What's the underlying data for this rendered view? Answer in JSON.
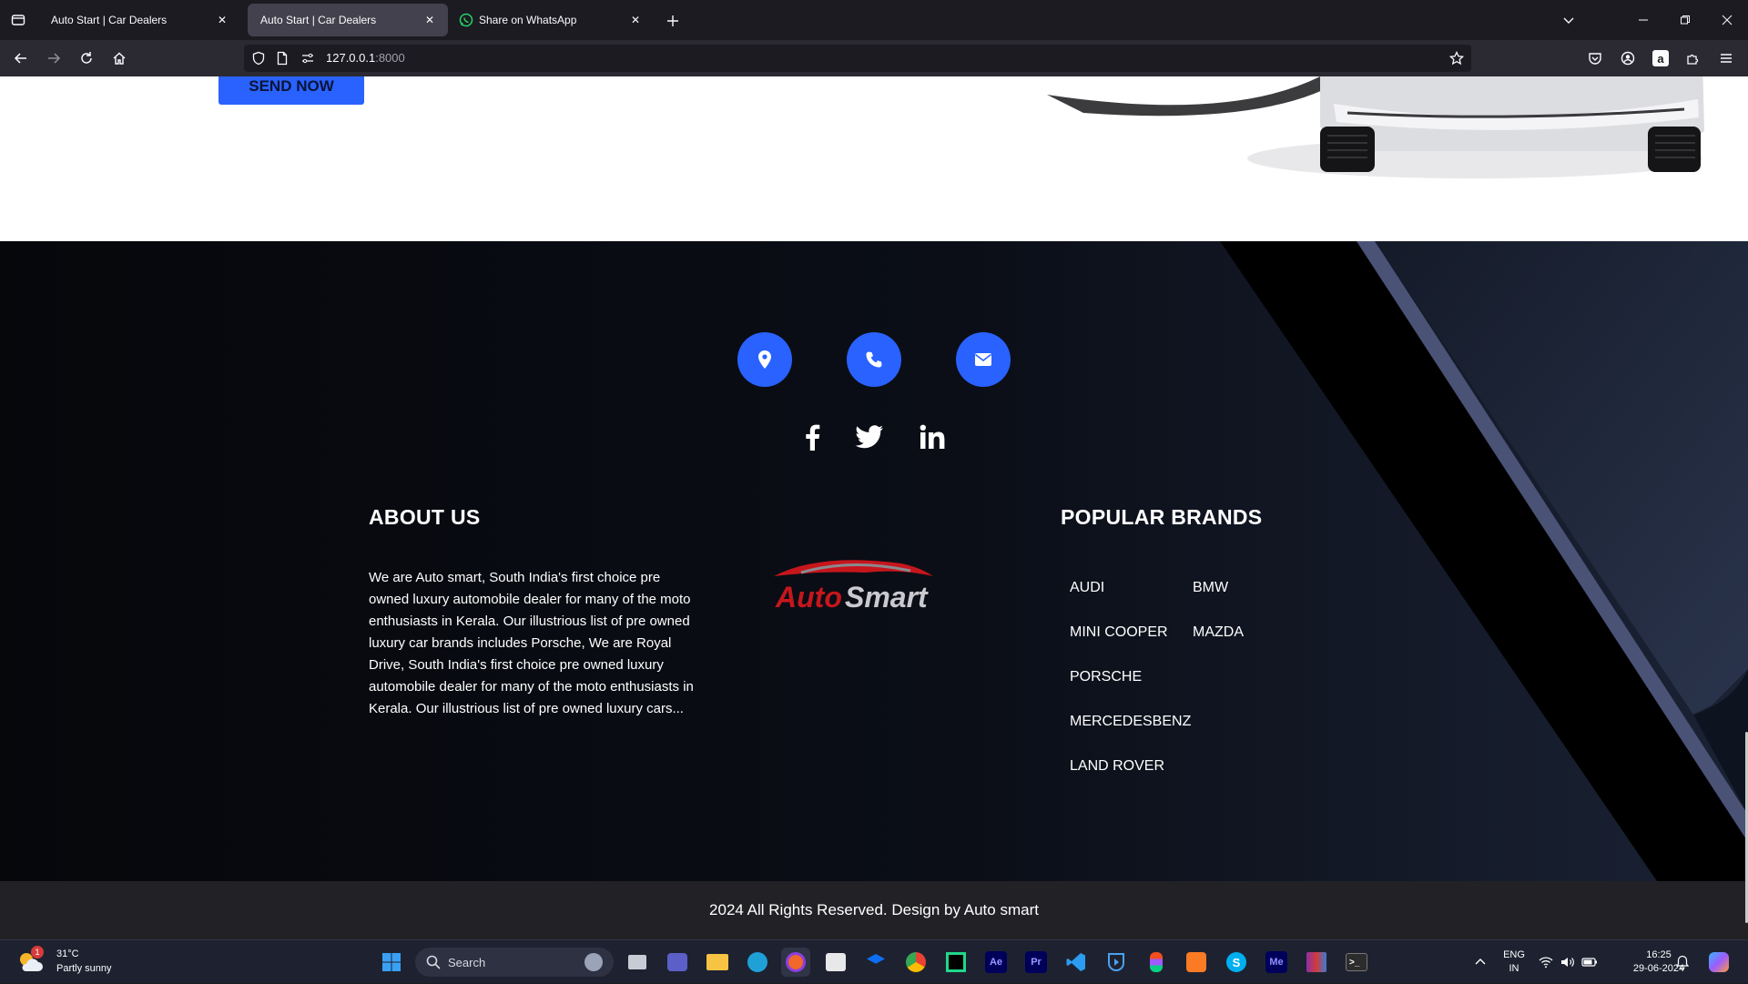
{
  "browser": {
    "tabs": [
      {
        "title": "Auto Start | Car Dealers",
        "active": false
      },
      {
        "title": "Auto Start | Car Dealers",
        "active": true
      },
      {
        "title": "Share on WhatsApp",
        "active": false
      }
    ],
    "url_host": "127.0.0.1",
    "url_port": ":8000"
  },
  "page": {
    "send_button": "SEND NOW",
    "contact_icons": [
      "location-pin-icon",
      "phone-icon",
      "envelope-icon"
    ],
    "social_icons": [
      "facebook-icon",
      "twitter-icon",
      "linkedin-icon"
    ],
    "about": {
      "heading": "ABOUT US",
      "text": "We are Auto smart, South India's first choice pre owned luxury automobile dealer for many of the moto enthusiasts in Kerala. Our illustrious list of pre owned luxury car brands includes Porsche, We are Royal Drive, South India's first choice pre owned luxury automobile dealer for many of the moto enthusiasts in Kerala. Our illustrious list of pre owned luxury cars..."
    },
    "logo": {
      "part1": "Auto",
      "part2": "Smart"
    },
    "brands": {
      "heading": "POPULAR BRANDS",
      "items": [
        "AUDI",
        "BMW",
        "MINI COOPER",
        "MAZDA",
        "PORSCHE",
        "MERCEDESBENZ",
        "LAND ROVER"
      ]
    },
    "copyright": "2024 All Rights Reserved. Design by Auto smart",
    "colors": {
      "accent": "#2962ff",
      "footer_bg": "#06070b",
      "stripe": "#4a5276"
    }
  },
  "taskbar": {
    "weather_temp": "31°C",
    "weather_desc": "Partly sunny",
    "weather_badge": "1",
    "search_placeholder": "Search",
    "apps": [
      "Ae",
      "Pr",
      "Me"
    ],
    "lang_top": "ENG",
    "lang_bottom": "IN",
    "time": "16:25",
    "date": "29-06-2024"
  }
}
